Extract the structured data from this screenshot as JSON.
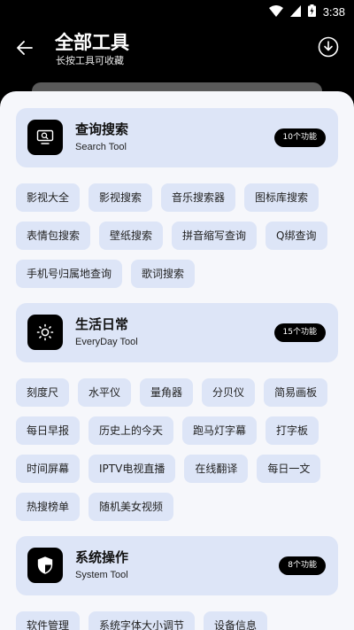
{
  "status_bar": {
    "time": "3:38"
  },
  "header": {
    "title": "全部工具",
    "subtitle": "长按工具可收藏"
  },
  "categories": [
    {
      "title": "查询搜索",
      "subtitle": "Search Tool",
      "badge": "10个功能",
      "icon": "search-monitor-icon",
      "rows": [
        [
          "影视大全",
          "影视搜索",
          "音乐搜索器",
          "图标库搜索"
        ],
        [
          "表情包搜索",
          "壁纸搜索",
          "拼音缩写查询",
          "Q绑查询"
        ],
        [
          "手机号归属地查询",
          "歌词搜索"
        ]
      ]
    },
    {
      "title": "生活日常",
      "subtitle": "EveryDay Tool",
      "badge": "15个功能",
      "icon": "sun-icon",
      "rows": [
        [
          "刻度尺",
          "水平仪",
          "量角器",
          "分贝仪",
          "简易画板"
        ],
        [
          "每日早报",
          "历史上的今天",
          "跑马灯字幕",
          "打字板"
        ],
        [
          "时间屏幕",
          "IPTV电视直播",
          "在线翻译",
          "每日一文"
        ],
        [
          "热搜榜单",
          "随机美女视频"
        ]
      ]
    },
    {
      "title": "系统操作",
      "subtitle": "System Tool",
      "badge": "8个功能",
      "icon": "shield-icon",
      "rows": [
        [
          "软件管理",
          "系统字体大小调节",
          "设备信息"
        ]
      ]
    }
  ]
}
